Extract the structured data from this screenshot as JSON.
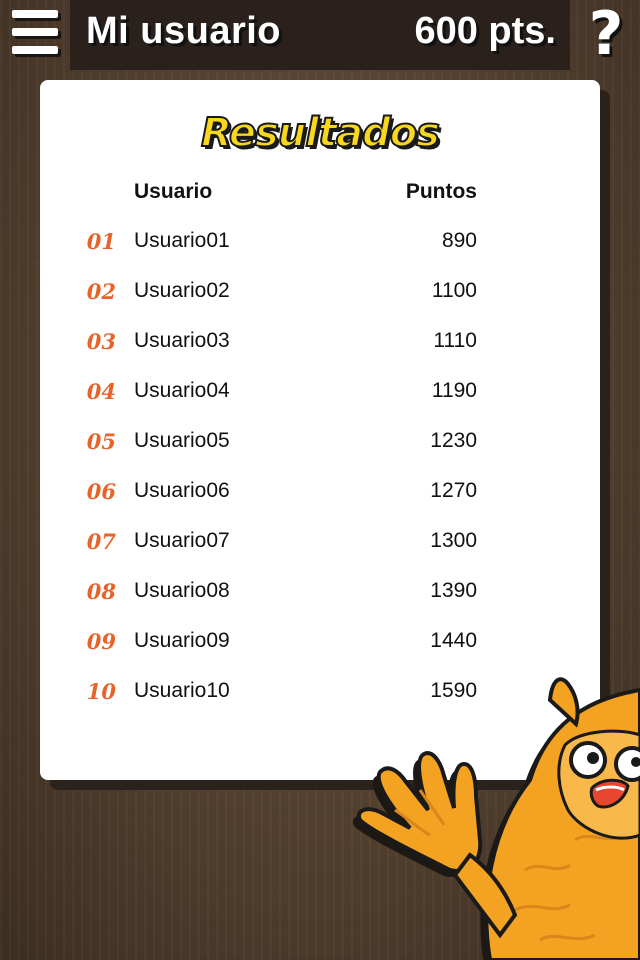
{
  "header": {
    "title": "Mi usuario",
    "points": "600 pts.",
    "help_symbol": "?"
  },
  "results": {
    "title": "Resultados",
    "col_user": "Usuario",
    "col_points": "Puntos",
    "rows": [
      {
        "rank": "01",
        "user": "Usuario01",
        "points": "890"
      },
      {
        "rank": "02",
        "user": "Usuario02",
        "points": "1100"
      },
      {
        "rank": "03",
        "user": "Usuario03",
        "points": "1110"
      },
      {
        "rank": "04",
        "user": "Usuario04",
        "points": "1190"
      },
      {
        "rank": "05",
        "user": "Usuario05",
        "points": "1230"
      },
      {
        "rank": "06",
        "user": "Usuario06",
        "points": "1270"
      },
      {
        "rank": "07",
        "user": "Usuario07",
        "points": "1300"
      },
      {
        "rank": "08",
        "user": "Usuario08",
        "points": "1390"
      },
      {
        "rank": "09",
        "user": "Usuario09",
        "points": "1440"
      },
      {
        "rank": "10",
        "user": "Usuario10",
        "points": "1590"
      }
    ]
  },
  "icons": {
    "menu": "hamburger-menu-icon",
    "help": "question-mark-icon",
    "mascot": "owl-mascot"
  },
  "colors": {
    "rank": "#e6642a",
    "title_fill": "#f9d71c",
    "owl_orange": "#f4a221"
  }
}
